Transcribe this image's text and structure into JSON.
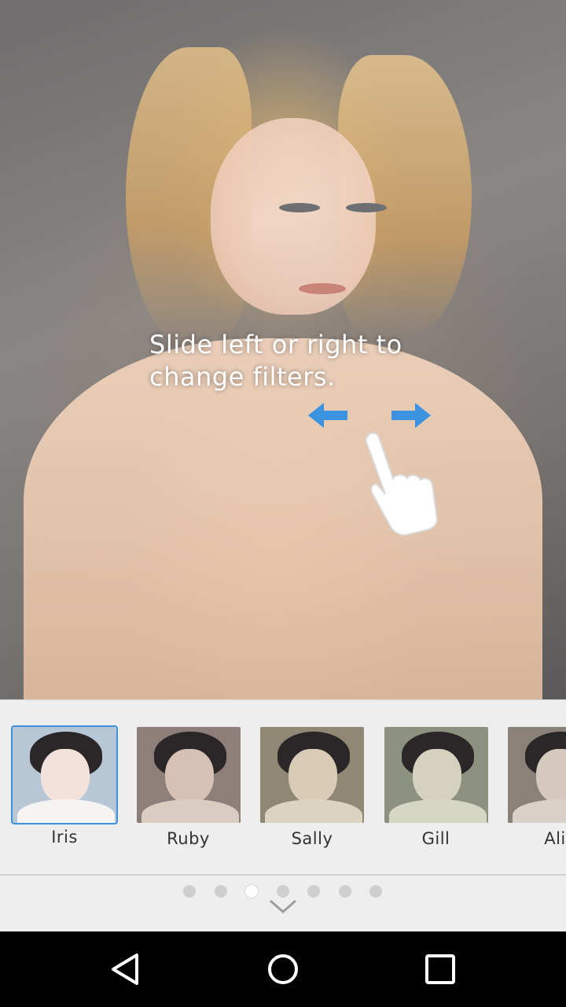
{
  "hint": {
    "text": "Slide left or right to change filters."
  },
  "filters": [
    {
      "label": "Iris",
      "selected": true,
      "tint": "#b8c7d6",
      "face": "#f3e2db",
      "shirt": "#f6f4f2"
    },
    {
      "label": "Ruby",
      "selected": false,
      "tint": "#8e7f7b",
      "face": "#d6c1b4",
      "shirt": "#d9cdc2"
    },
    {
      "label": "Sally",
      "selected": false,
      "tint": "#918775",
      "face": "#dacbb7",
      "shirt": "#ddd3c1"
    },
    {
      "label": "Gill",
      "selected": false,
      "tint": "#8d917f",
      "face": "#d4d1bf",
      "shirt": "#d6d6c4"
    },
    {
      "label": "Alic",
      "selected": false,
      "tint": "#8a8279",
      "face": "#d5c8bd",
      "shirt": "#dad1c8"
    }
  ],
  "pager": {
    "count": 7,
    "active_index": 2
  },
  "icons": {
    "left_arrow": "arrow-left-icon",
    "right_arrow": "arrow-right-icon",
    "hand": "swipe-hand-icon",
    "collapse": "chevron-down-icon",
    "back": "back-triangle-icon",
    "home": "home-circle-icon",
    "recents": "recents-square-icon"
  },
  "colors": {
    "accent": "#3b93df",
    "strip_bg": "#eeeeee"
  }
}
